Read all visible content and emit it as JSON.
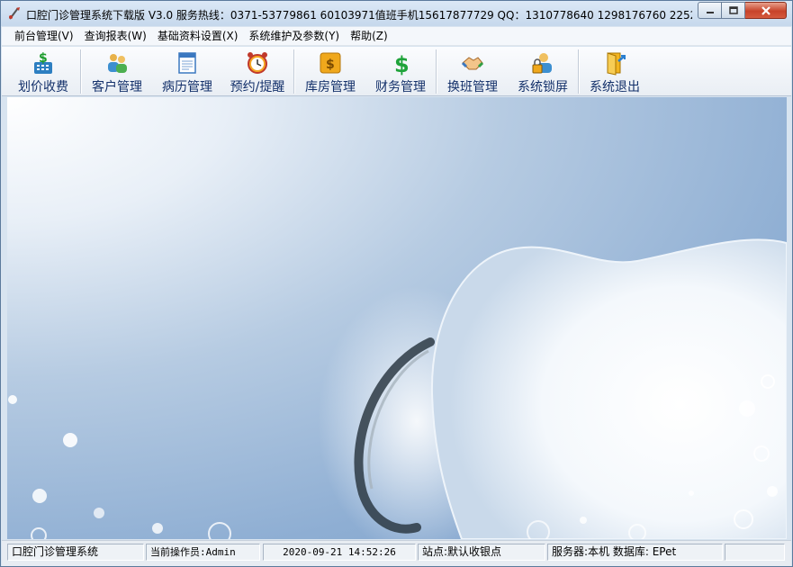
{
  "window": {
    "title": "口腔门诊管理系统下载版 V3.0  服务热线：0371-53779861 60103971值班手机15617877729  QQ：1310778640 1298176760 2252..."
  },
  "menu": {
    "items": [
      "前台管理(V)",
      "查询报表(W)",
      "基础资料设置(X)",
      "系统维护及参数(Y)",
      "帮助(Z)"
    ]
  },
  "toolbar": {
    "buttons": [
      {
        "label": "划价收费",
        "icon": "cash-register-icon"
      },
      {
        "label": "客户管理",
        "icon": "users-icon"
      },
      {
        "label": "病历管理",
        "icon": "document-icon"
      },
      {
        "label": "预约/提醒",
        "icon": "alarm-clock-icon"
      },
      {
        "label": "库房管理",
        "icon": "money-bag-icon"
      },
      {
        "label": "财务管理",
        "icon": "dollar-icon"
      },
      {
        "label": "换班管理",
        "icon": "handshake-icon"
      },
      {
        "label": "系统锁屏",
        "icon": "lock-user-icon"
      },
      {
        "label": "系统退出",
        "icon": "exit-door-icon"
      }
    ]
  },
  "status": {
    "app_name": "口腔门诊管理系统",
    "operator": "当前操作员:Admin",
    "datetime": "2020-09-21 14:52:26",
    "station": "站点:默认收银点",
    "server": "服务器:本机  数据库: EPet",
    "extra": ""
  },
  "colors": {
    "toolbar_label": "#13306a",
    "background_blue": "#7d9fca"
  }
}
